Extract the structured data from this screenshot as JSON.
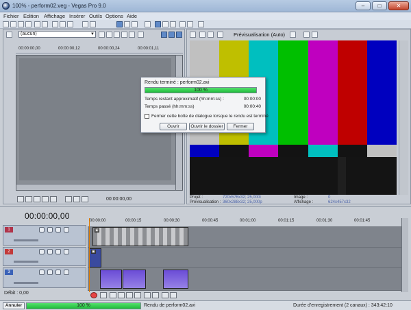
{
  "window": {
    "title": "100% - perform02.veg - Vegas Pro 9.0",
    "min_symbol": "–",
    "max_symbol": "□",
    "close_symbol": "✕"
  },
  "menu": [
    "Fichier",
    "Edition",
    "Affichage",
    "Insérer",
    "Outils",
    "Options",
    "Aide"
  ],
  "left_panel": {
    "preset": "(aucun)",
    "ruler_labels": [
      "00:00:00,00",
      "00:00:00,12",
      "00:00:00,24",
      "00:00:01,11",
      "00:00:01,23"
    ],
    "time": "00:00:00,00"
  },
  "right_panel": {
    "preview_quality": "Prévisualisation (Auto)",
    "info": {
      "projet_label": "Projet :",
      "projet_value": "720x576x32; 25,000i",
      "previs_label": "Prévisualisation :",
      "previs_value": "360x288x32; 25,000p",
      "image_label": "Image :",
      "image_value": "0",
      "affichage_label": "Affichage :",
      "affichage_value": "624x457x32"
    },
    "bars": {
      "top": [
        "#c0c0c0",
        "#bfbf00",
        "#00bfbf",
        "#00bf00",
        "#bf00bf",
        "#bf0000",
        "#0000bf"
      ],
      "middle": [
        "#0000bf",
        "#131313",
        "#bf00bf",
        "#131313",
        "#00bfbf",
        "#131313",
        "#c0c0c0"
      ]
    }
  },
  "dialog": {
    "title": "Rendu terminé : perform02.avi",
    "progress_percent": 100,
    "progress_label": "100 %",
    "remaining_label": "Temps restant approximatif (hh:mm:ss) :",
    "remaining_value": "00:00:00",
    "elapsed_label": "Temps passé (hh:mm:ss)",
    "elapsed_value": "00:00:40",
    "close_checkbox_label": "Fermer cette boîte de dialogue lorsque le rendu est terminé",
    "buttons": {
      "open": "Ouvrir",
      "open_folder": "Ouvrir le dossier",
      "close": "Fermer"
    }
  },
  "timeline": {
    "timecode": "00:00:00,00",
    "ruler_ticks": [
      "00:00:00",
      "00:00:15",
      "00:00:30",
      "00:00:45",
      "00:01:00",
      "00:01:15",
      "00:01:30",
      "00:01:45"
    ],
    "tracks": [
      {
        "number": "1",
        "color": "#b0344a"
      },
      {
        "number": "2",
        "color": "#c23a3a"
      },
      {
        "number": "3",
        "color": "#3a62b8"
      }
    ],
    "debit": "Débit : 0,00"
  },
  "statusbar": {
    "cancel": "Annuler",
    "progress_percent": 100,
    "progress_label": "100 %",
    "message": "Rendu de perform02.avi",
    "duration": "Durée d'enregistrement (2 canaux) : 343:42:10"
  }
}
